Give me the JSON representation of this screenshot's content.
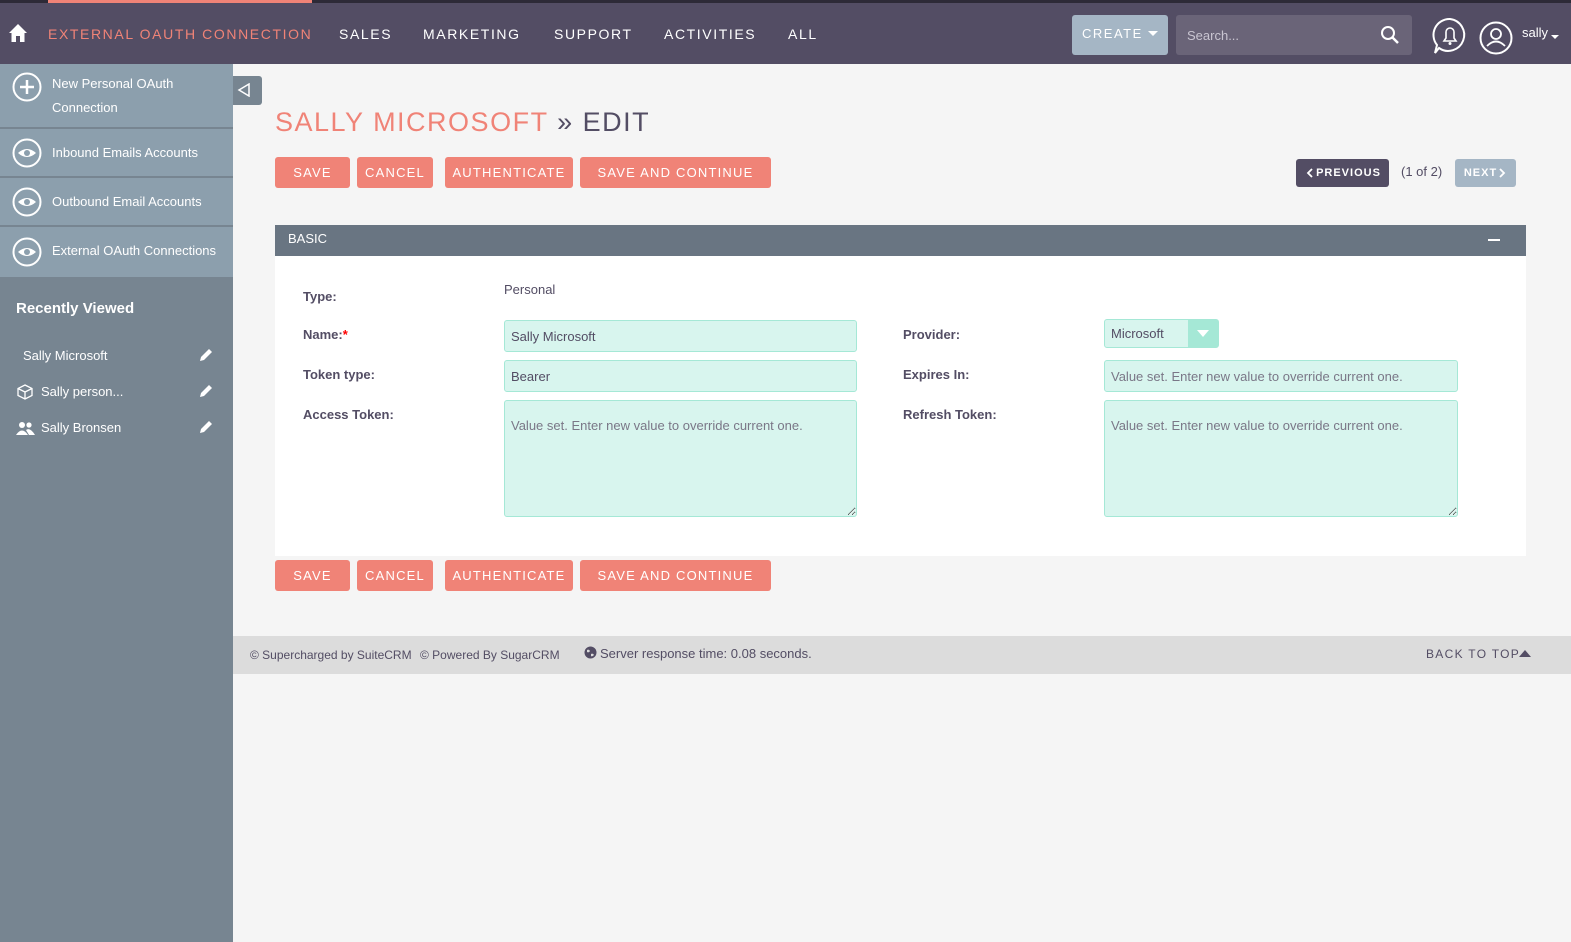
{
  "nav": {
    "active_module": "EXTERNAL OAUTH CONNECTION",
    "items": [
      "SALES",
      "MARKETING",
      "SUPPORT",
      "ACTIVITIES",
      "ALL"
    ],
    "create_label": "CREATE",
    "search_placeholder": "Search...",
    "username": "sally"
  },
  "sidebar": {
    "actions": [
      {
        "label_line1": "New Personal OAuth",
        "label_line2": "Connection",
        "icon": "plus-icon"
      },
      {
        "label": "Inbound Emails Accounts",
        "icon": "eye-icon"
      },
      {
        "label": "Outbound Email Accounts",
        "icon": "eye-icon"
      },
      {
        "label": "External OAuth Connections",
        "icon": "eye-icon"
      }
    ],
    "recent_title": "Recently Viewed",
    "recent": [
      {
        "label": "Sally Microsoft",
        "icon": ""
      },
      {
        "label": "Sally person...",
        "icon": "cube-icon"
      },
      {
        "label": "Sally Bronsen",
        "icon": "users-icon"
      }
    ]
  },
  "page": {
    "module_title": "SALLY MICROSOFT",
    "separator": "»",
    "action_title": "EDIT"
  },
  "buttons": {
    "save": "SAVE",
    "cancel": "CANCEL",
    "authenticate": "AUTHENTICATE",
    "save_continue": "SAVE AND CONTINUE"
  },
  "pager": {
    "previous": "PREVIOUS",
    "count": "(1 of 2)",
    "next": "NEXT"
  },
  "panel": {
    "title": "BASIC",
    "type_label": "Type:",
    "type_value": "Personal",
    "name_label": "Name:",
    "name_required": "*",
    "name_value": "Sally Microsoft",
    "provider_label": "Provider:",
    "provider_value": "Microsoft",
    "token_type_label": "Token type:",
    "token_type_value": "Bearer",
    "expires_label": "Expires In:",
    "access_token_label": "Access Token:",
    "refresh_token_label": "Refresh Token:",
    "value_set_placeholder": "Value set. Enter new value to override current one."
  },
  "footer": {
    "suitecrm": "© Supercharged by SuiteCRM",
    "sugarcrm": "© Powered By SugarCRM",
    "server_time": "Server response time: 0.08 seconds.",
    "back_to_top": "BACK TO TOP"
  },
  "colors": {
    "nav_bg": "#534d64",
    "accent": "#f08377",
    "sidebar_bg": "#778591",
    "sidebar_action_bg": "#8c9fad",
    "field_bg": "#d8f5ee",
    "panel_head": "#697582"
  }
}
